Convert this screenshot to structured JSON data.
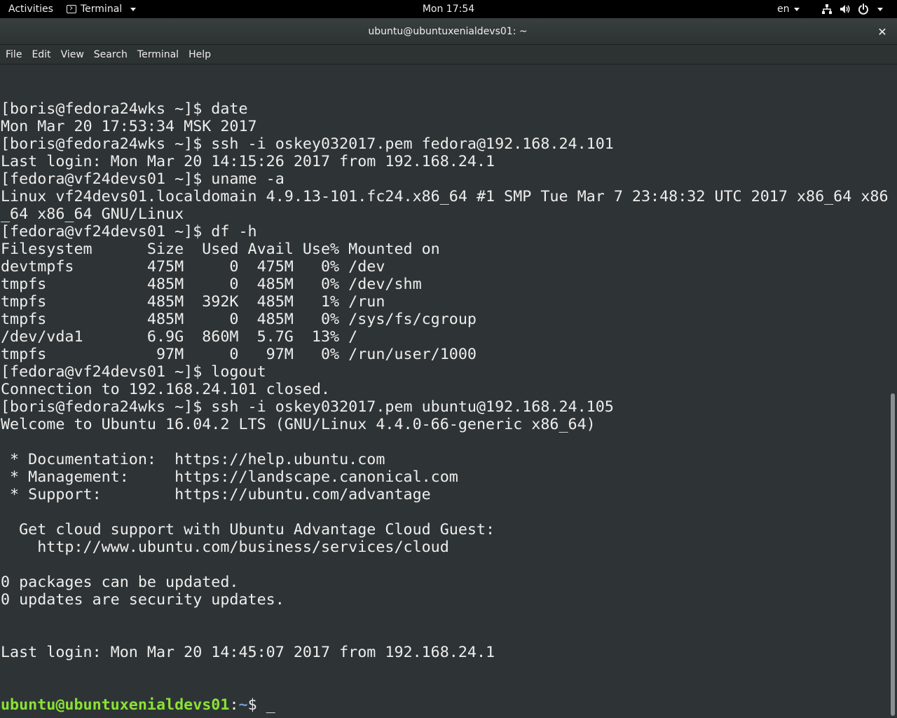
{
  "topbar": {
    "activities": "Activities",
    "app_menu": "Terminal",
    "clock": "Mon 17:54",
    "language": "en",
    "tray_icons": [
      "network-icon",
      "volume-icon",
      "power-icon"
    ]
  },
  "window": {
    "title": "ubuntu@ubuntuxenialdevs01: ~",
    "close": "✕"
  },
  "menubar": {
    "items": [
      "File",
      "Edit",
      "View",
      "Search",
      "Terminal",
      "Help"
    ]
  },
  "terminal": {
    "lines": [
      "[boris@fedora24wks ~]$ date",
      "Mon Mar 20 17:53:34 MSK 2017",
      "[boris@fedora24wks ~]$ ssh -i oskey032017.pem fedora@192.168.24.101",
      "Last login: Mon Mar 20 14:15:26 2017 from 192.168.24.1",
      "[fedora@vf24devs01 ~]$ uname -a",
      "Linux vf24devs01.localdomain 4.9.13-101.fc24.x86_64 #1 SMP Tue Mar 7 23:48:32 UTC 2017 x86_64 x86",
      "_64 x86_64 GNU/Linux",
      "[fedora@vf24devs01 ~]$ df -h",
      "Filesystem      Size  Used Avail Use% Mounted on",
      "devtmpfs        475M     0  475M   0% /dev",
      "tmpfs           485M     0  485M   0% /dev/shm",
      "tmpfs           485M  392K  485M   1% /run",
      "tmpfs           485M     0  485M   0% /sys/fs/cgroup",
      "/dev/vda1       6.9G  860M  5.7G  13% /",
      "tmpfs            97M     0   97M   0% /run/user/1000",
      "[fedora@vf24devs01 ~]$ logout",
      "Connection to 192.168.24.101 closed.",
      "[boris@fedora24wks ~]$ ssh -i oskey032017.pem ubuntu@192.168.24.105",
      "Welcome to Ubuntu 16.04.2 LTS (GNU/Linux 4.4.0-66-generic x86_64)",
      "",
      " * Documentation:  https://help.ubuntu.com",
      " * Management:     https://landscape.canonical.com",
      " * Support:        https://ubuntu.com/advantage",
      "",
      "  Get cloud support with Ubuntu Advantage Cloud Guest:",
      "    http://www.ubuntu.com/business/services/cloud",
      "",
      "0 packages can be updated.",
      "0 updates are security updates.",
      "",
      "",
      "Last login: Mon Mar 20 14:45:07 2017 from 192.168.24.1"
    ],
    "prompt": {
      "user_host": "ubuntu@ubuntuxenialdevs01",
      "colon": ":",
      "path": "~",
      "dollar": "$ ",
      "cursor": "_"
    },
    "colors": {
      "background": "#2e3436",
      "foreground": "#eeeeec",
      "prompt_user": "#8ae234",
      "prompt_path": "#729fcf"
    }
  }
}
